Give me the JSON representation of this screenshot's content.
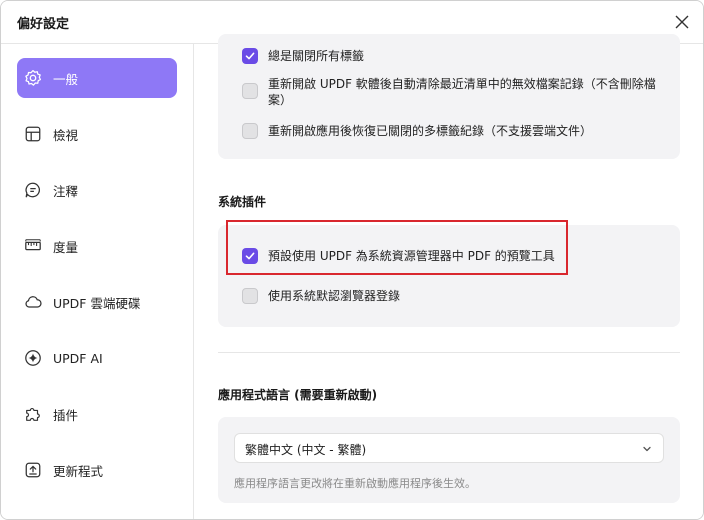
{
  "window": {
    "title": "偏好設定"
  },
  "sidebar": {
    "items": [
      {
        "label": "一般",
        "icon": "gear-icon"
      },
      {
        "label": "檢視",
        "icon": "grid-icon"
      },
      {
        "label": "注釋",
        "icon": "comment-icon"
      },
      {
        "label": "度量",
        "icon": "ruler-icon"
      },
      {
        "label": "UPDF 雲端硬碟",
        "icon": "cloud-icon"
      },
      {
        "label": "UPDF AI",
        "icon": "ai-icon"
      },
      {
        "label": "插件",
        "icon": "puzzle-icon"
      },
      {
        "label": "更新程式",
        "icon": "update-icon"
      }
    ]
  },
  "tabs_section": {
    "options": [
      {
        "label": "總是關閉所有標籤",
        "checked": true
      },
      {
        "label": "重新開啟 UPDF 軟體後自動清除最近清單中的無效檔案記錄（不含刪除檔案）",
        "line1": "重新開啟 UPDF 軟體後自動清除最近清單中的無效檔案記錄（不含刪除檔",
        "line2": "案）",
        "checked": false
      },
      {
        "label": "重新開啟應用後恢復已關閉的多標籤紀錄（不支援雲端文件）",
        "checked": false
      }
    ]
  },
  "plugin_section": {
    "title": "系統插件",
    "options": [
      {
        "label": "預設使用 UPDF 為系統資源管理器中 PDF 的預覽工具",
        "checked": true
      },
      {
        "label": "使用系統默認瀏覽器登錄",
        "checked": false
      }
    ]
  },
  "language_section": {
    "title": "應用程式語言 (需要重新啟動)",
    "selected": "繁體中文 (中文 - 繁體)",
    "hint": "應用程序語言更改將在重新啟動應用程序後生效。"
  },
  "colors": {
    "accent": "#8e78f6",
    "checkbox_on": "#6a4be6",
    "highlight_border": "#d9272e"
  }
}
